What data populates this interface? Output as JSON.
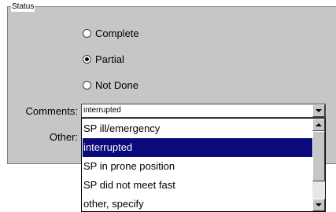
{
  "status_group": {
    "title": "Status",
    "options": [
      {
        "label": "Complete",
        "checked": false
      },
      {
        "label": "Partial",
        "checked": true
      },
      {
        "label": "Not Done",
        "checked": false
      }
    ]
  },
  "comments": {
    "label": "Comments:",
    "value": "interrupted",
    "dropdown_open": true,
    "options": [
      {
        "label": "SP ill/emergency",
        "selected": false
      },
      {
        "label": "interrupted",
        "selected": true
      },
      {
        "label": "SP in prone position",
        "selected": false
      },
      {
        "label": "SP did not meet fast",
        "selected": false
      },
      {
        "label": "other, specify",
        "selected": false
      }
    ]
  },
  "other": {
    "label": "Other:"
  },
  "colors": {
    "panel_background": "#c6c6c6",
    "selection_background": "#0a0a7a",
    "selection_text": "#ffffff"
  }
}
